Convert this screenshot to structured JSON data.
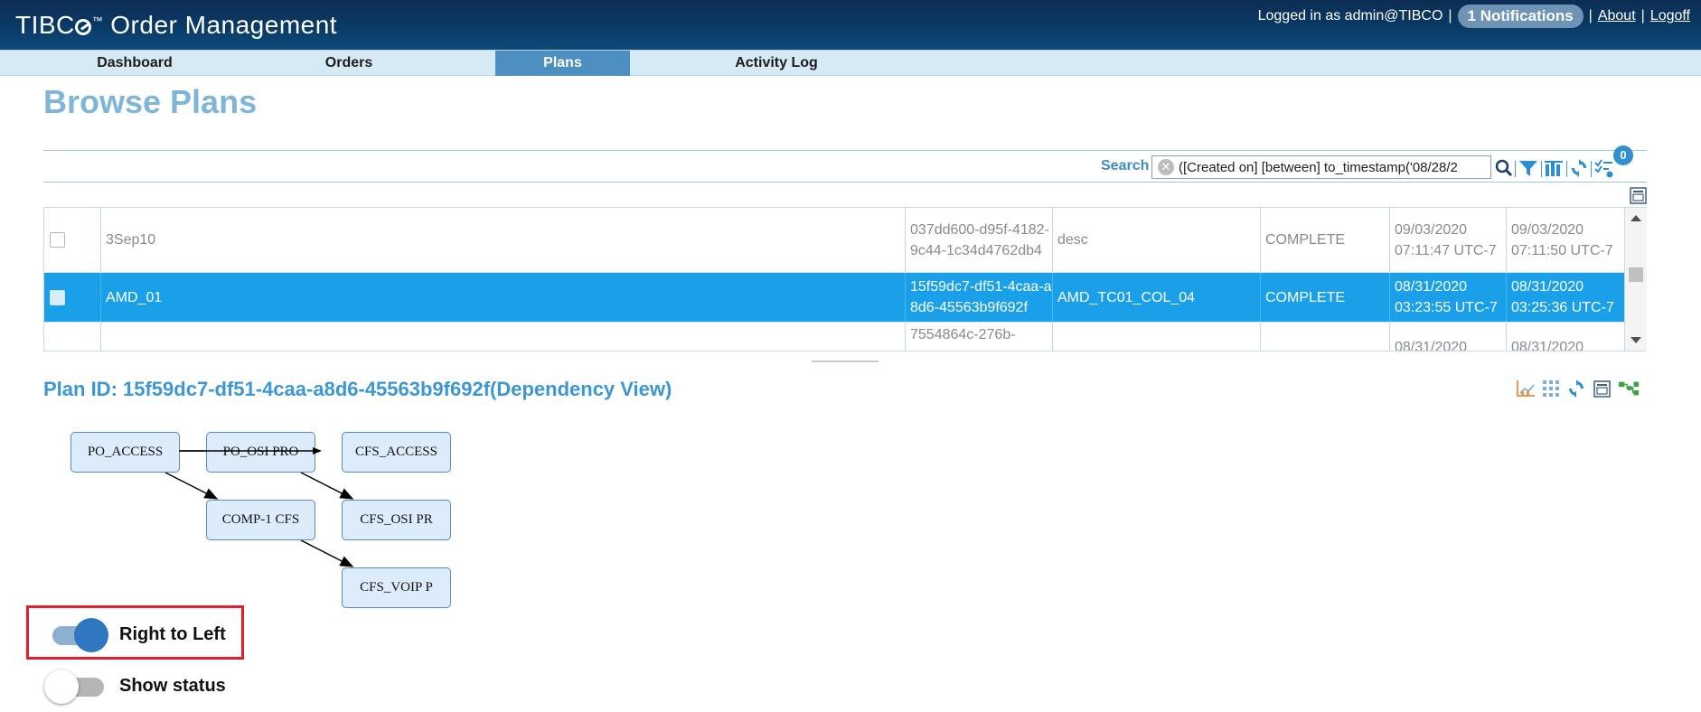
{
  "header": {
    "brand_logo": "TIBC",
    "trademark": "™",
    "app_title": "Order Management",
    "logged_in_text": "Logged in as admin@TIBCO",
    "separator": "|",
    "notifications_label": "1 Notifications",
    "about_link": "About",
    "logoff_link": "Logoff",
    "bg_color": "#0a3a66"
  },
  "nav": {
    "tabs": [
      {
        "label": "Dashboard",
        "active": false
      },
      {
        "label": "Orders",
        "active": false
      },
      {
        "label": "Plans",
        "active": true
      },
      {
        "label": "Activity Log",
        "active": false
      }
    ],
    "active_color": "#4d8fc0"
  },
  "page_title": "Browse Plans",
  "search": {
    "label": "Search",
    "query": "([Created on] [between] to_timestamp('08/28/2",
    "badge_count": "0",
    "tools": [
      "search-icon",
      "filter-icon",
      "columns-icon",
      "refresh-icon",
      "checklist-icon"
    ]
  },
  "plans_table": {
    "rows": [
      {
        "name": "3Sep10",
        "plan_id": "037dd600-d95f-4182-9c44-1c34d4762db4",
        "description": "desc",
        "status": "COMPLETE",
        "created": "09/03/2020 07:11:47 UTC-7",
        "modified": "09/03/2020 07:11:50 UTC-7",
        "selected": false
      },
      {
        "name": "AMD_01",
        "plan_id": "15f59dc7-df51-4caa-a8d6-45563b9f692f",
        "description": "AMD_TC01_COL_04",
        "status": "COMPLETE",
        "created": "08/31/2020 03:23:55 UTC-7",
        "modified": "08/31/2020 03:25:36 UTC-7",
        "selected": true
      },
      {
        "name": "",
        "plan_id": "7554864c-276b-",
        "description": "",
        "status": "",
        "created": "08/31/2020",
        "modified": "08/31/2020",
        "selected": false
      }
    ],
    "selected_color": "#1aa0e8"
  },
  "plan_detail": {
    "title": "Plan ID: 15f59dc7-df51-4caa-a8d6-45563b9f692f(Dependency View)",
    "tools": [
      "chart-icon",
      "grid-icon",
      "refresh-icon",
      "collapse-icon",
      "tree-icon"
    ]
  },
  "dependency_graph": {
    "nodes": [
      "PO_ACCESS",
      "PO_OSI PRO",
      "CFS_ACCESS",
      "COMP-1 CFS",
      "CFS_OSI PR",
      "CFS_VOIP P"
    ]
  },
  "toggles": {
    "right_to_left": {
      "label": "Right to Left",
      "on": true
    },
    "show_status": {
      "label": "Show status",
      "on": false
    },
    "highlight_color": "#e0202a"
  }
}
